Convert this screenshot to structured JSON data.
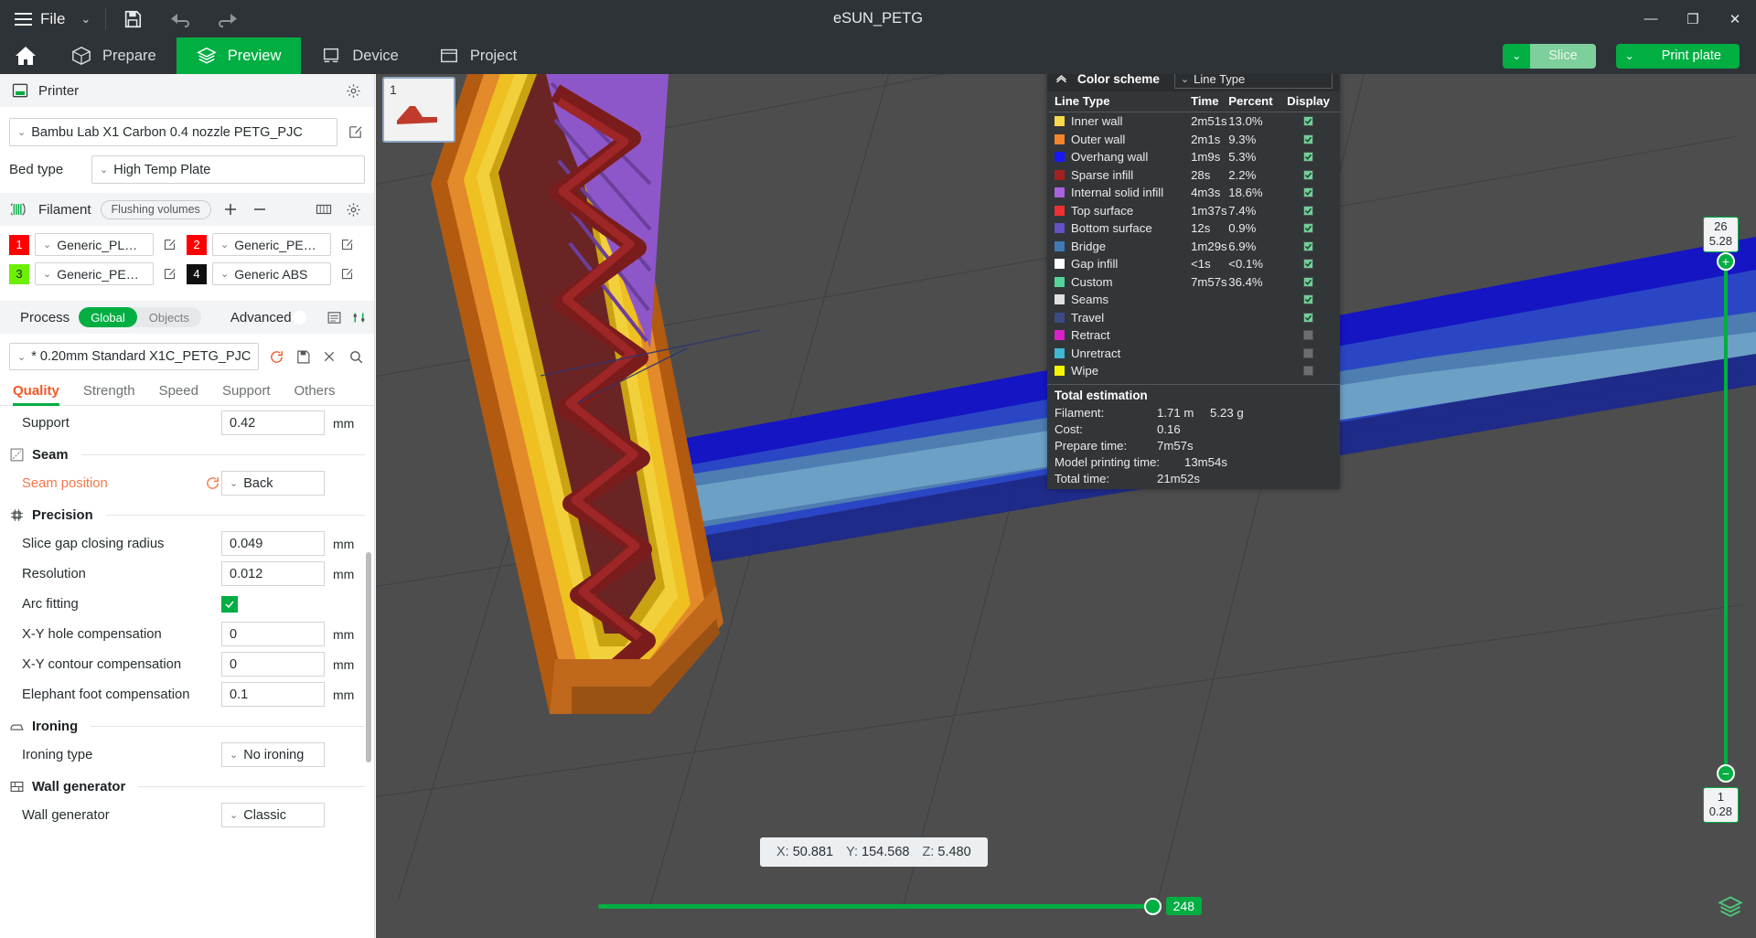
{
  "window": {
    "title": "eSUN_PETG",
    "minimize": "—",
    "maximize": "❐",
    "close": "✕"
  },
  "titlebar": {
    "file_label": "File",
    "caret": "⌄",
    "save_icon": "save-icon",
    "undo_icon": "undo-icon",
    "redo_icon": "redo-icon"
  },
  "navbar": {
    "home_icon": "home-icon",
    "tabs": [
      {
        "label": "Prepare",
        "icon": "cube-icon",
        "active": false
      },
      {
        "label": "Preview",
        "icon": "layers-icon",
        "active": true
      },
      {
        "label": "Device",
        "icon": "printer-icon",
        "active": false
      },
      {
        "label": "Project",
        "icon": "project-icon",
        "active": false
      }
    ],
    "slice_caret": "⌄",
    "slice_label": "Slice",
    "print_caret": "⌄",
    "print_label": "Print plate"
  },
  "printer": {
    "section_label": "Printer",
    "gear_icon": "gear-icon",
    "preset": "Bambu Lab X1 Carbon 0.4 nozzle PETG_PJC",
    "edit_icon": "edit-icon",
    "bed_type_label": "Bed type",
    "bed_type_value": "High Temp Plate"
  },
  "filament": {
    "section_label": "Filament",
    "flushing_volumes": "Flushing volumes",
    "add_icon": "plus-icon",
    "remove_icon": "minus-icon",
    "ams_icon": "ams-icon",
    "gear_icon": "gear-icon",
    "items": [
      {
        "index": "1",
        "color": "#ff0000",
        "name": "Generic_PLA+_eS...",
        "edit_icon": "edit-icon"
      },
      {
        "index": "2",
        "color": "#ff0000",
        "name": "Generic_PETG_eS...",
        "edit_icon": "edit-icon"
      },
      {
        "index": "3",
        "color": "#6cf000",
        "name": "Generic_PETG_eS...",
        "edit_icon": "edit-icon"
      },
      {
        "index": "4",
        "color": "#101010",
        "name": "Generic ABS",
        "edit_icon": "edit-icon"
      }
    ]
  },
  "process": {
    "section_label": "Process",
    "seg_global": "Global",
    "seg_objects": "Objects",
    "advanced_label": "Advanced",
    "advanced_on": true,
    "list_icon": "list-icon",
    "compare_icon": "compare-icon",
    "preset": "* 0.20mm Standard X1C_PETG_PJC",
    "reset_icon": "reset-icon",
    "save_icon": "save-icon",
    "delete_icon": "close-icon",
    "search_icon": "search-icon",
    "tabs": [
      {
        "label": "Quality",
        "active": true
      },
      {
        "label": "Strength",
        "active": false
      },
      {
        "label": "Speed",
        "active": false
      },
      {
        "label": "Support",
        "active": false
      },
      {
        "label": "Others",
        "active": false
      }
    ]
  },
  "settings": {
    "rows": [
      {
        "type": "field",
        "label": "Support",
        "value": "0.42",
        "unit": "mm",
        "modified": false
      },
      {
        "type": "group",
        "label": "Seam",
        "icon": "seam-icon"
      },
      {
        "type": "dropdown",
        "label": "Seam position",
        "value": "Back",
        "unit": "",
        "modified": true,
        "reset_icon": "reset-icon"
      },
      {
        "type": "group",
        "label": "Precision",
        "icon": "precision-icon"
      },
      {
        "type": "field",
        "label": "Slice gap closing radius",
        "value": "0.049",
        "unit": "mm",
        "modified": false
      },
      {
        "type": "field",
        "label": "Resolution",
        "value": "0.012",
        "unit": "mm",
        "modified": false
      },
      {
        "type": "checkbox",
        "label": "Arc fitting",
        "checked": true,
        "unit": "",
        "modified": false
      },
      {
        "type": "field",
        "label": "X-Y hole compensation",
        "value": "0",
        "unit": "mm",
        "modified": false
      },
      {
        "type": "field",
        "label": "X-Y contour compensation",
        "value": "0",
        "unit": "mm",
        "modified": false
      },
      {
        "type": "field",
        "label": "Elephant foot compensation",
        "value": "0.1",
        "unit": "mm",
        "modified": false
      },
      {
        "type": "group",
        "label": "Ironing",
        "icon": "ironing-icon"
      },
      {
        "type": "dropdown",
        "label": "Ironing type",
        "value": "No ironing",
        "unit": "",
        "modified": false
      },
      {
        "type": "group",
        "label": "Wall generator",
        "icon": "wall-icon"
      },
      {
        "type": "dropdown",
        "label": "Wall generator",
        "value": "Classic",
        "unit": "",
        "modified": false
      }
    ]
  },
  "viewport": {
    "plate_thumb_number": "1",
    "coordinates": {
      "x_key": "X:",
      "x_val": "50.881",
      "y_key": "Y:",
      "y_val": "154.568",
      "z_key": "Z:",
      "z_val": "5.480"
    },
    "horizontal_slider_value": "248",
    "vertical_slider_top_layer": "26",
    "vertical_slider_top_height": "5.28",
    "vertical_slider_bottom_layer": "1",
    "vertical_slider_bottom_height": "0.28",
    "layers_icon": "layers-icon"
  },
  "legend": {
    "collapse_icon": "chevron-up-icon",
    "title": "Color scheme",
    "scheme_value": "Line Type",
    "columns": {
      "type": "Line Type",
      "time": "Time",
      "percent": "Percent",
      "display": "Display"
    },
    "rows": [
      {
        "color": "#f5d84b",
        "label": "Inner wall",
        "time": "2m51s",
        "percent": "13.0%",
        "display": true
      },
      {
        "color": "#f5832b",
        "label": "Outer wall",
        "time": "2m1s",
        "percent": "9.3%",
        "display": true
      },
      {
        "color": "#1818f5",
        "label": "Overhang wall",
        "time": "1m9s",
        "percent": "5.3%",
        "display": true
      },
      {
        "color": "#a32020",
        "label": "Sparse infill",
        "time": "28s",
        "percent": "2.2%",
        "display": true
      },
      {
        "color": "#a862de",
        "label": "Internal solid infill",
        "time": "4m3s",
        "percent": "18.6%",
        "display": true
      },
      {
        "color": "#ee3030",
        "label": "Top surface",
        "time": "1m37s",
        "percent": "7.4%",
        "display": true
      },
      {
        "color": "#6450c8",
        "label": "Bottom surface",
        "time": "12s",
        "percent": "0.9%",
        "display": true
      },
      {
        "color": "#4179b4",
        "label": "Bridge",
        "time": "1m29s",
        "percent": "6.9%",
        "display": true
      },
      {
        "color": "#ffffff",
        "label": "Gap infill",
        "time": "<1s",
        "percent": "<0.1%",
        "display": true
      },
      {
        "color": "#53d49a",
        "label": "Custom",
        "time": "7m57s",
        "percent": "36.4%",
        "display": true
      },
      {
        "color": "#e0e0e0",
        "label": "Seams",
        "time": "",
        "percent": "",
        "display": true
      },
      {
        "color": "#3b4a86",
        "label": "Travel",
        "time": "",
        "percent": "",
        "display": true
      },
      {
        "color": "#d820c8",
        "label": "Retract",
        "time": "",
        "percent": "",
        "display": false
      },
      {
        "color": "#3fb8d2",
        "label": "Unretract",
        "time": "",
        "percent": "",
        "display": false
      },
      {
        "color": "#f5f500",
        "label": "Wipe",
        "time": "",
        "percent": "",
        "display": false
      }
    ],
    "total": {
      "heading": "Total estimation",
      "filament_key": "Filament:",
      "filament_len": "1.71 m",
      "filament_weight": "5.23 g",
      "cost_key": "Cost:",
      "cost_val": "0.16",
      "prepare_key": "Prepare time:",
      "prepare_val": "7m57s",
      "model_key": "Model printing time:",
      "model_val": "13m54s",
      "total_key": "Total time:",
      "total_val": "21m52s"
    }
  },
  "colors": {
    "accent_green": "#00ae42",
    "orange": "#f05a28",
    "dark_chrome": "#2e3338",
    "viewport_bg": "#4d4d4d"
  }
}
